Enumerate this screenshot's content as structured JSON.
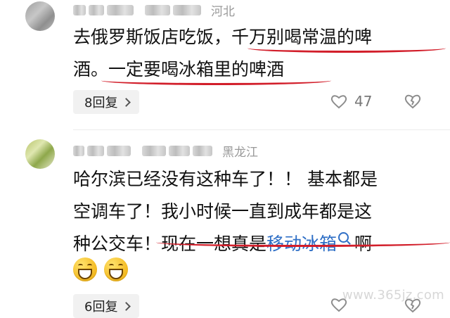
{
  "comments": [
    {
      "region": "河北",
      "text_part1": "去俄罗斯饭店吃饭，",
      "text_part2": "千万别喝常温的啤",
      "text_part3": "酒。一定要喝冰箱里的啤酒",
      "reply_label": "8回复",
      "likes": "47"
    },
    {
      "region": "黑龙江",
      "line1": "哈尔滨已经没有这种车了！！ 基本都是",
      "line2": "空调车了！我小时候一直到成年都是这",
      "line3_prefix": "种公交车！现在一想真是",
      "line3_link": "移动冰箱",
      "line3_suffix": "啊",
      "reply_label": "6回复"
    }
  ],
  "watermark": "www.365jz.com",
  "icons": {
    "reply_chevron": "chevron-right-icon",
    "like": "heart-icon",
    "dislike": "broken-heart-icon",
    "link_search": "search-icon",
    "emoji": "grinning-face-icon"
  },
  "colors": {
    "link": "#2f6fc6",
    "underline": "#d21e2a",
    "region": "#999999",
    "button_bg": "#f1f1f1"
  }
}
